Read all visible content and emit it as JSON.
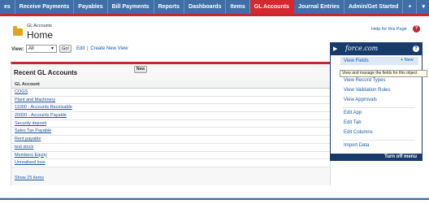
{
  "tabs": [
    {
      "label": "es",
      "active": false
    },
    {
      "label": "Receive Payments",
      "active": false
    },
    {
      "label": "Payables",
      "active": false
    },
    {
      "label": "Bill Payments",
      "active": false
    },
    {
      "label": "Reports",
      "active": false
    },
    {
      "label": "Dashboards",
      "active": false
    },
    {
      "label": "Items",
      "active": false
    },
    {
      "label": "GL Accounts",
      "active": true
    },
    {
      "label": "Journal Entries",
      "active": false
    },
    {
      "label": "Admin/Get Started",
      "active": false
    },
    {
      "label": "+",
      "active": false
    },
    {
      "label": "▾",
      "active": false
    }
  ],
  "header": {
    "breadcrumb": "GL Accounts",
    "title": "Home",
    "help_link": "Help for this Page",
    "help_icon": "?"
  },
  "view": {
    "label": "View:",
    "selected": "All",
    "go_label": "Go!",
    "edit_link": "Edit",
    "separator": "|",
    "create_link": "Create New View"
  },
  "recent": {
    "title": "Recent GL Accounts",
    "new_label": "New",
    "column_header": "GL Account",
    "rows": [
      "COGS",
      "Plant and Machinery",
      "11000 - Accounts Receivable",
      "20000 - Accounts Payable",
      "Security deposit",
      "Sales Tax Payable",
      "Rent payable",
      "test stock",
      "Members Equity",
      "Unrealised loss"
    ],
    "show_more": "Show 25 items"
  },
  "force_menu": {
    "logo": "force.com",
    "help": "?",
    "items": [
      "View Fields",
      "View Record Types",
      "View Validation Rules",
      "View Approvals",
      "Edit App",
      "Edit Tab",
      "Edit Columns",
      "Import Data"
    ],
    "new_label": "New",
    "tooltip": "View and manage the fields for this object",
    "footer": "Turn off menu"
  },
  "colors": {
    "tab_bar": "#3f6fa6",
    "active_tab": "#d6282f",
    "menu_header": "#173b6a",
    "link": "#1a5bb0"
  }
}
